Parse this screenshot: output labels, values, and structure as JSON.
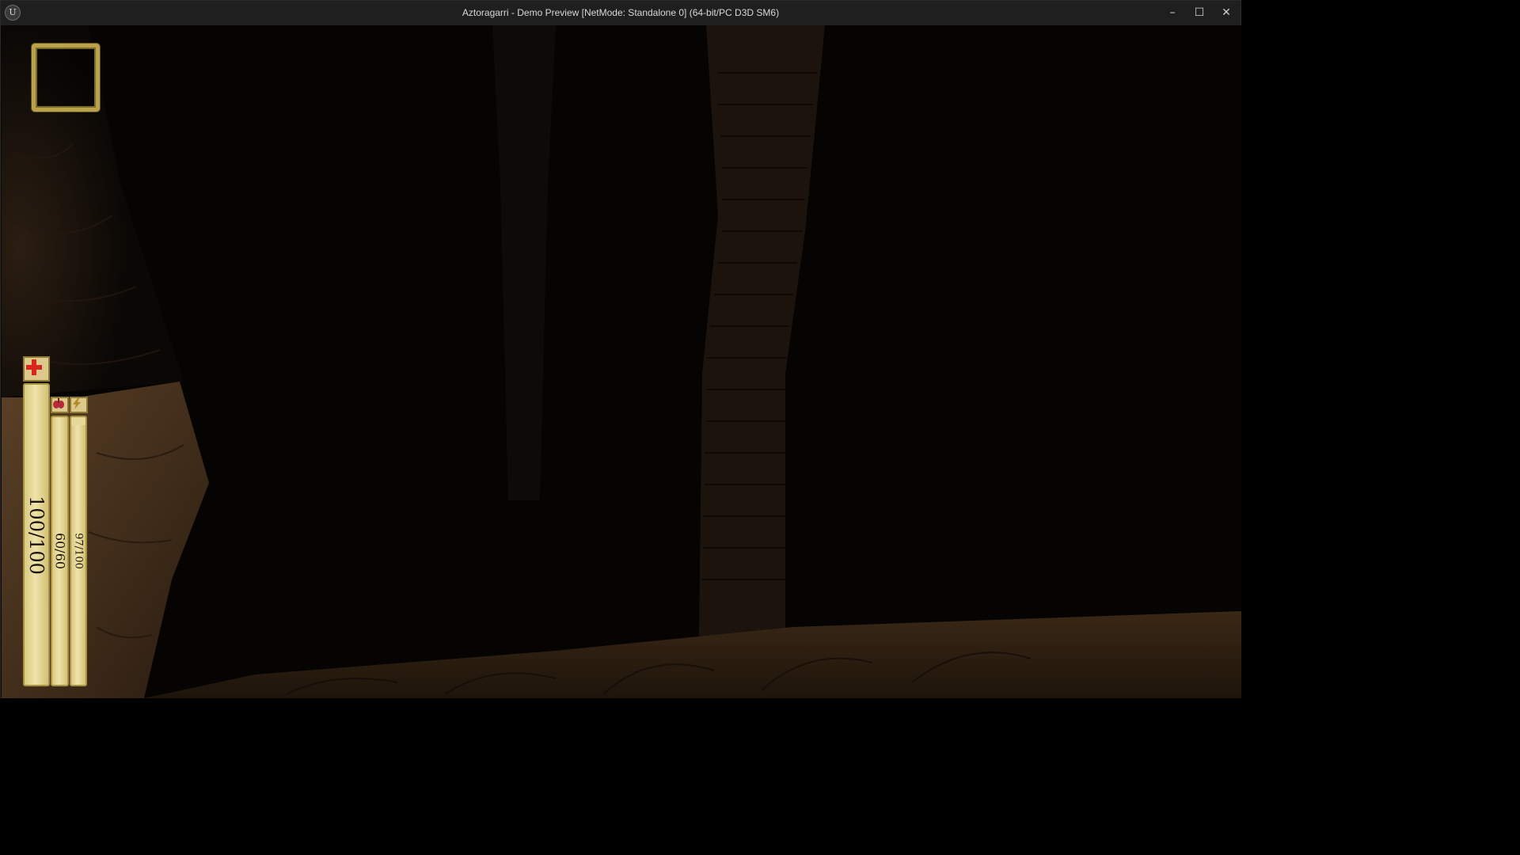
{
  "window": {
    "title": "Aztoragarri - Demo Preview [NetMode: Standalone 0]  (64-bit/PC D3D SM6)",
    "app_icon_glyph": "U",
    "minimize_glyph": "–",
    "maximize_glyph": "☐",
    "close_glyph": "✕"
  },
  "hud": {
    "health": {
      "text": "100/100",
      "current": 100,
      "max": 100,
      "icon": "red-cross-icon",
      "color": "#d8281e"
    },
    "stamina": {
      "text": "60/60",
      "current": 60,
      "max": 60,
      "icon": "lungs-icon",
      "color": "#b8283a"
    },
    "energy": {
      "text": "97/100",
      "current": 97,
      "max": 100,
      "icon": "lightning-icon",
      "color": "#b08a2a"
    }
  }
}
